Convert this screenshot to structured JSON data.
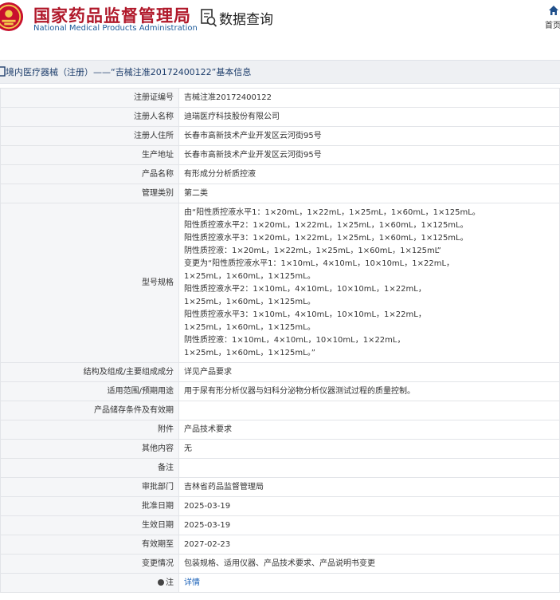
{
  "header": {
    "site_name_cn": "国家药品监督管理局",
    "site_name_en": "National Medical Products Administration",
    "query_title": "数据查询",
    "home_label": "首页",
    "emblem_icon": "emblem-icon",
    "query_icon": "document-search-icon",
    "home_icon": "home-icon"
  },
  "section": {
    "title": "境内医疗器械（注册）——“吉械注准20172400122”基本信息",
    "icon": "bookmark-icon"
  },
  "rows": [
    {
      "label": "注册证编号",
      "value": "吉械注准20172400122"
    },
    {
      "label": "注册人名称",
      "value": "迪瑞医疗科技股份有限公司"
    },
    {
      "label": "注册人住所",
      "value": "长春市高新技术产业开发区云河街95号"
    },
    {
      "label": "生产地址",
      "value": "长春市高新技术产业开发区云河街95号"
    },
    {
      "label": "产品名称",
      "value": "有形成分分析质控液"
    },
    {
      "label": "管理类别",
      "value": "第二类"
    },
    {
      "label": "型号规格",
      "lines": [
        "由“阳性质控液水平1：1×20mL，1×22mL，1×25mL，1×60mL，1×125mL。",
        "阳性质控液水平2：1×20mL，1×22mL，1×25mL，1×60mL，1×125mL。",
        "阳性质控液水平3：1×20mL，1×22mL，1×25mL，1×60mL，1×125mL。",
        "阴性质控液：1×20mL，1×22mL，1×25mL，1×60mL，1×125mL”",
        "变更为“阳性质控液水平1：1×10mL，4×10mL，10×10mL，1×22mL，",
        "1×25mL，1×60mL，1×125mL。",
        "阳性质控液水平2：1×10mL，4×10mL，10×10mL，1×22mL，",
        "1×25mL，1×60mL，1×125mL。",
        "阳性质控液水平3：1×10mL，4×10mL，10×10mL，1×22mL，",
        "1×25mL，1×60mL，1×125mL。",
        "阴性质控液：1×10mL，4×10mL，10×10mL，1×22mL，",
        "1×25mL，1×60mL，1×125mL。”"
      ]
    },
    {
      "label": "结构及组成/主要组成成分",
      "value": "详见产品要求"
    },
    {
      "label": "适用范围/预期用途",
      "value": "用于尿有形分析仪器与妇科分泌物分析仪器测试过程的质量控制。"
    },
    {
      "label": "产品储存条件及有效期",
      "value": ""
    },
    {
      "label": "附件",
      "value": "产品技术要求"
    },
    {
      "label": "其他内容",
      "value": "无"
    },
    {
      "label": "备注",
      "value": ""
    },
    {
      "label": "审批部门",
      "value": "吉林省药品监督管理局"
    },
    {
      "label": "批准日期",
      "value": "2025-03-19"
    },
    {
      "label": "生效日期",
      "value": "2025-03-19"
    },
    {
      "label": "有效期至",
      "value": "2027-02-23"
    },
    {
      "label": "变更情况",
      "value": "包装规格、适用仪器、产品技术要求、产品说明书变更"
    },
    {
      "label": "注",
      "value": "详情",
      "label_icon": "dot-icon",
      "link": true
    }
  ]
}
